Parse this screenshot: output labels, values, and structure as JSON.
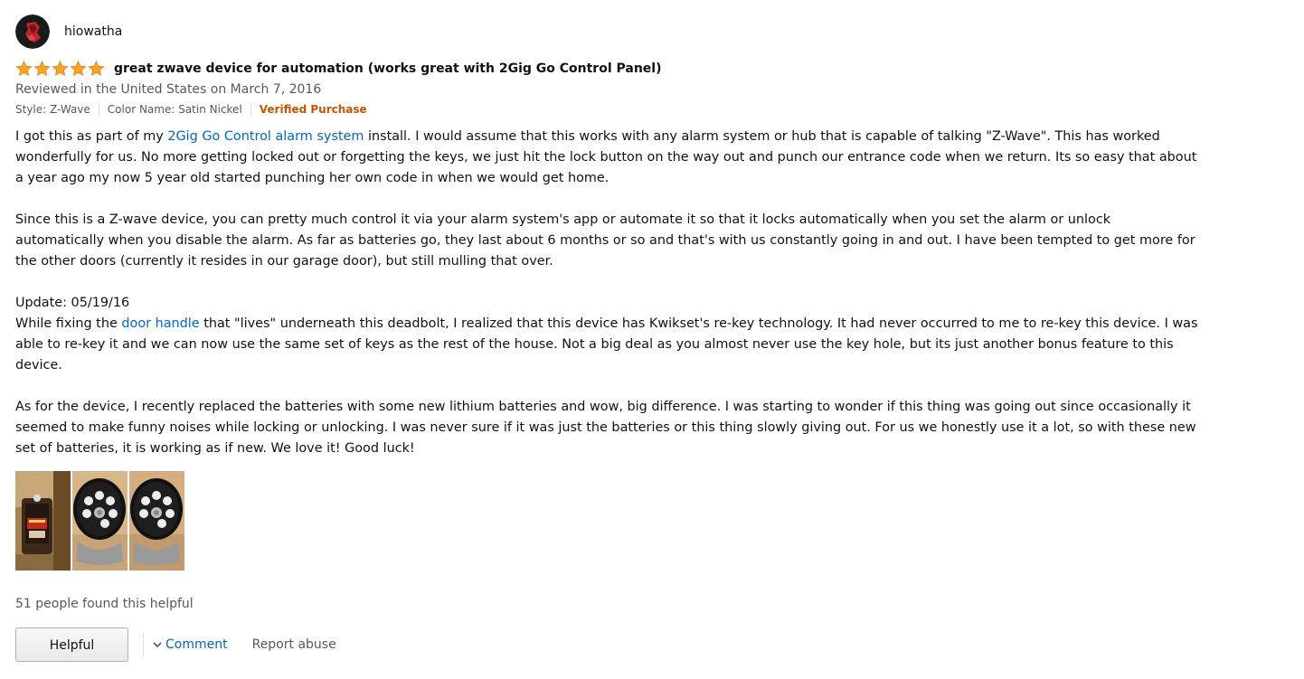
{
  "reviewer": {
    "name": "hiowatha",
    "avatar_icon": "avatar-icon"
  },
  "review": {
    "rating": 5,
    "rating_max": 5,
    "title": "great zwave device for automation (works great with 2Gig Go Control Panel)",
    "date": "Reviewed in the United States on March 7, 2016",
    "style": "Style: Z-Wave",
    "color_name": "Color Name: Satin Nickel",
    "verified": "Verified Purchase",
    "p1_before": "I got this as part of my ",
    "p1_link": "2Gig Go Control alarm system",
    "p1_after": " install. I would assume that this works with any alarm system or hub that is capable of talking \"Z-Wave\". This has worked wonderfully for us. No more getting locked out or forgetting the keys, we just hit the lock button on the way out and punch our entrance code when we return. Its so easy that about a year ago my now 5 year old started punching her own code in when we would get home.",
    "p2": "Since this is a Z-wave device, you can pretty much control it via your alarm system's app or automate it so that it locks automatically when you set the alarm or unlock automatically when you disable the alarm. As far as batteries go, they last about 6 months or so and that's with us constantly going in and out. I have been tempted to get more for the other doors (currently it resides in our garage door), but still mulling that over.",
    "update_label": "Update: 05/19/16",
    "p3_before": "While fixing the ",
    "p3_link": "door handle",
    "p3_after": " that \"lives\" underneath this deadbolt, I realized that this device has Kwikset's re-key technology. It had never occurred to me to re-key this device. I was able to re-key it and we can now use the same set of keys as the rest of the house. Not a big deal as you almost never use the key hole, but its just another bonus feature to this device.",
    "p4": "As for the device, I recently replaced the batteries with some new lithium batteries and wow, big difference. I was starting to wonder if this thing was going out since occasionally it seemed to make funny noises while locking or unlocking. I was never sure if it was just the batteries or this thing slowly giving out. For us we honestly use it a lot, so with these new set of batteries, it is working as if new. We love it! Good luck!"
  },
  "images": [
    {
      "name": "review-image-1",
      "subject": "battery-compartment"
    },
    {
      "name": "review-image-2",
      "subject": "keypad-deadbolt"
    },
    {
      "name": "review-image-3",
      "subject": "keypad-deadbolt"
    }
  ],
  "footer": {
    "helpful_count": "51 people found this helpful",
    "helpful_button": "Helpful",
    "comment_link": "Comment",
    "report_link": "Report abuse"
  },
  "colors": {
    "star": "#ffa41c",
    "link": "#0066c0",
    "verified": "#c45500",
    "muted": "#565959"
  }
}
